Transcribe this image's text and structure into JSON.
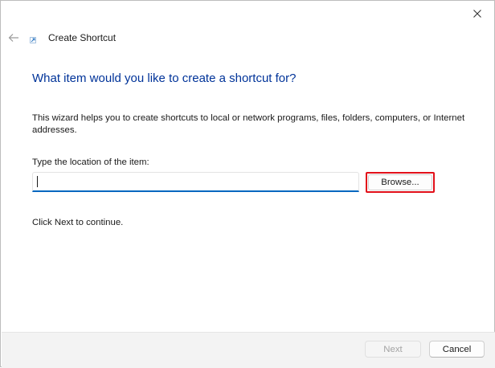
{
  "window": {
    "title": "Create Shortcut",
    "close_icon": "close-icon",
    "back_icon": "back-arrow-icon",
    "app_icon": "shortcut-icon"
  },
  "main": {
    "heading": "What item would you like to create a shortcut for?",
    "description": "This wizard helps you to create shortcuts to local or network programs, files, folders, computers, or Internet addresses.",
    "location_label": "Type the location of the item:",
    "location_value": "",
    "browse_label": "Browse...",
    "continue_text": "Click Next to continue."
  },
  "footer": {
    "next_label": "Next",
    "next_enabled": false,
    "cancel_label": "Cancel"
  },
  "colors": {
    "heading": "#003399",
    "input_focus": "#0067c0",
    "highlight": "#e2101a",
    "footer_bg": "#f3f3f3"
  }
}
